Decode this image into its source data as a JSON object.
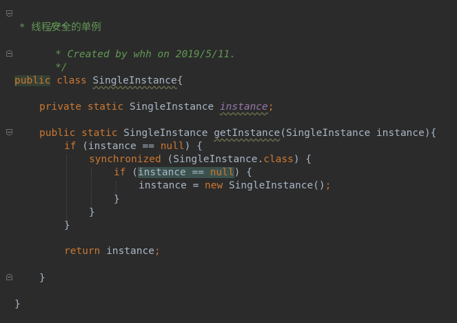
{
  "code": {
    "comment_open": "/**",
    "comment_desc_prefix": " * ",
    "comment_desc": "线程安全的单例",
    "comment_created": " * Created by whh on 2019/5/11.",
    "comment_close": " */",
    "kw_public": "public",
    "kw_class": "class",
    "class_name": "SingleInstance",
    "brace_open": "{",
    "brace_close": "}",
    "kw_private": "private",
    "kw_static": "static",
    "type_name": "SingleInstance",
    "field_name": "instance",
    "semicolon": ";",
    "method_name": "getInstance",
    "param_text": "(SingleInstance instance)",
    "kw_if": "if",
    "cond1": "(instance == ",
    "kw_null": "null",
    "cond_close": ") {",
    "kw_synchronized": "synchronized",
    "sync_arg_prefix": "(SingleInstance.",
    "kw_class2": "class",
    "sync_arg_suffix": ") {",
    "cond2_open": "(",
    "cond2_inner": "instance == ",
    "cond2_close": ") {",
    "assign_prefix": "instance = ",
    "kw_new": "new",
    "assign_suffix": " SingleInstance()",
    "kw_return": "return",
    "return_value": " instance"
  }
}
